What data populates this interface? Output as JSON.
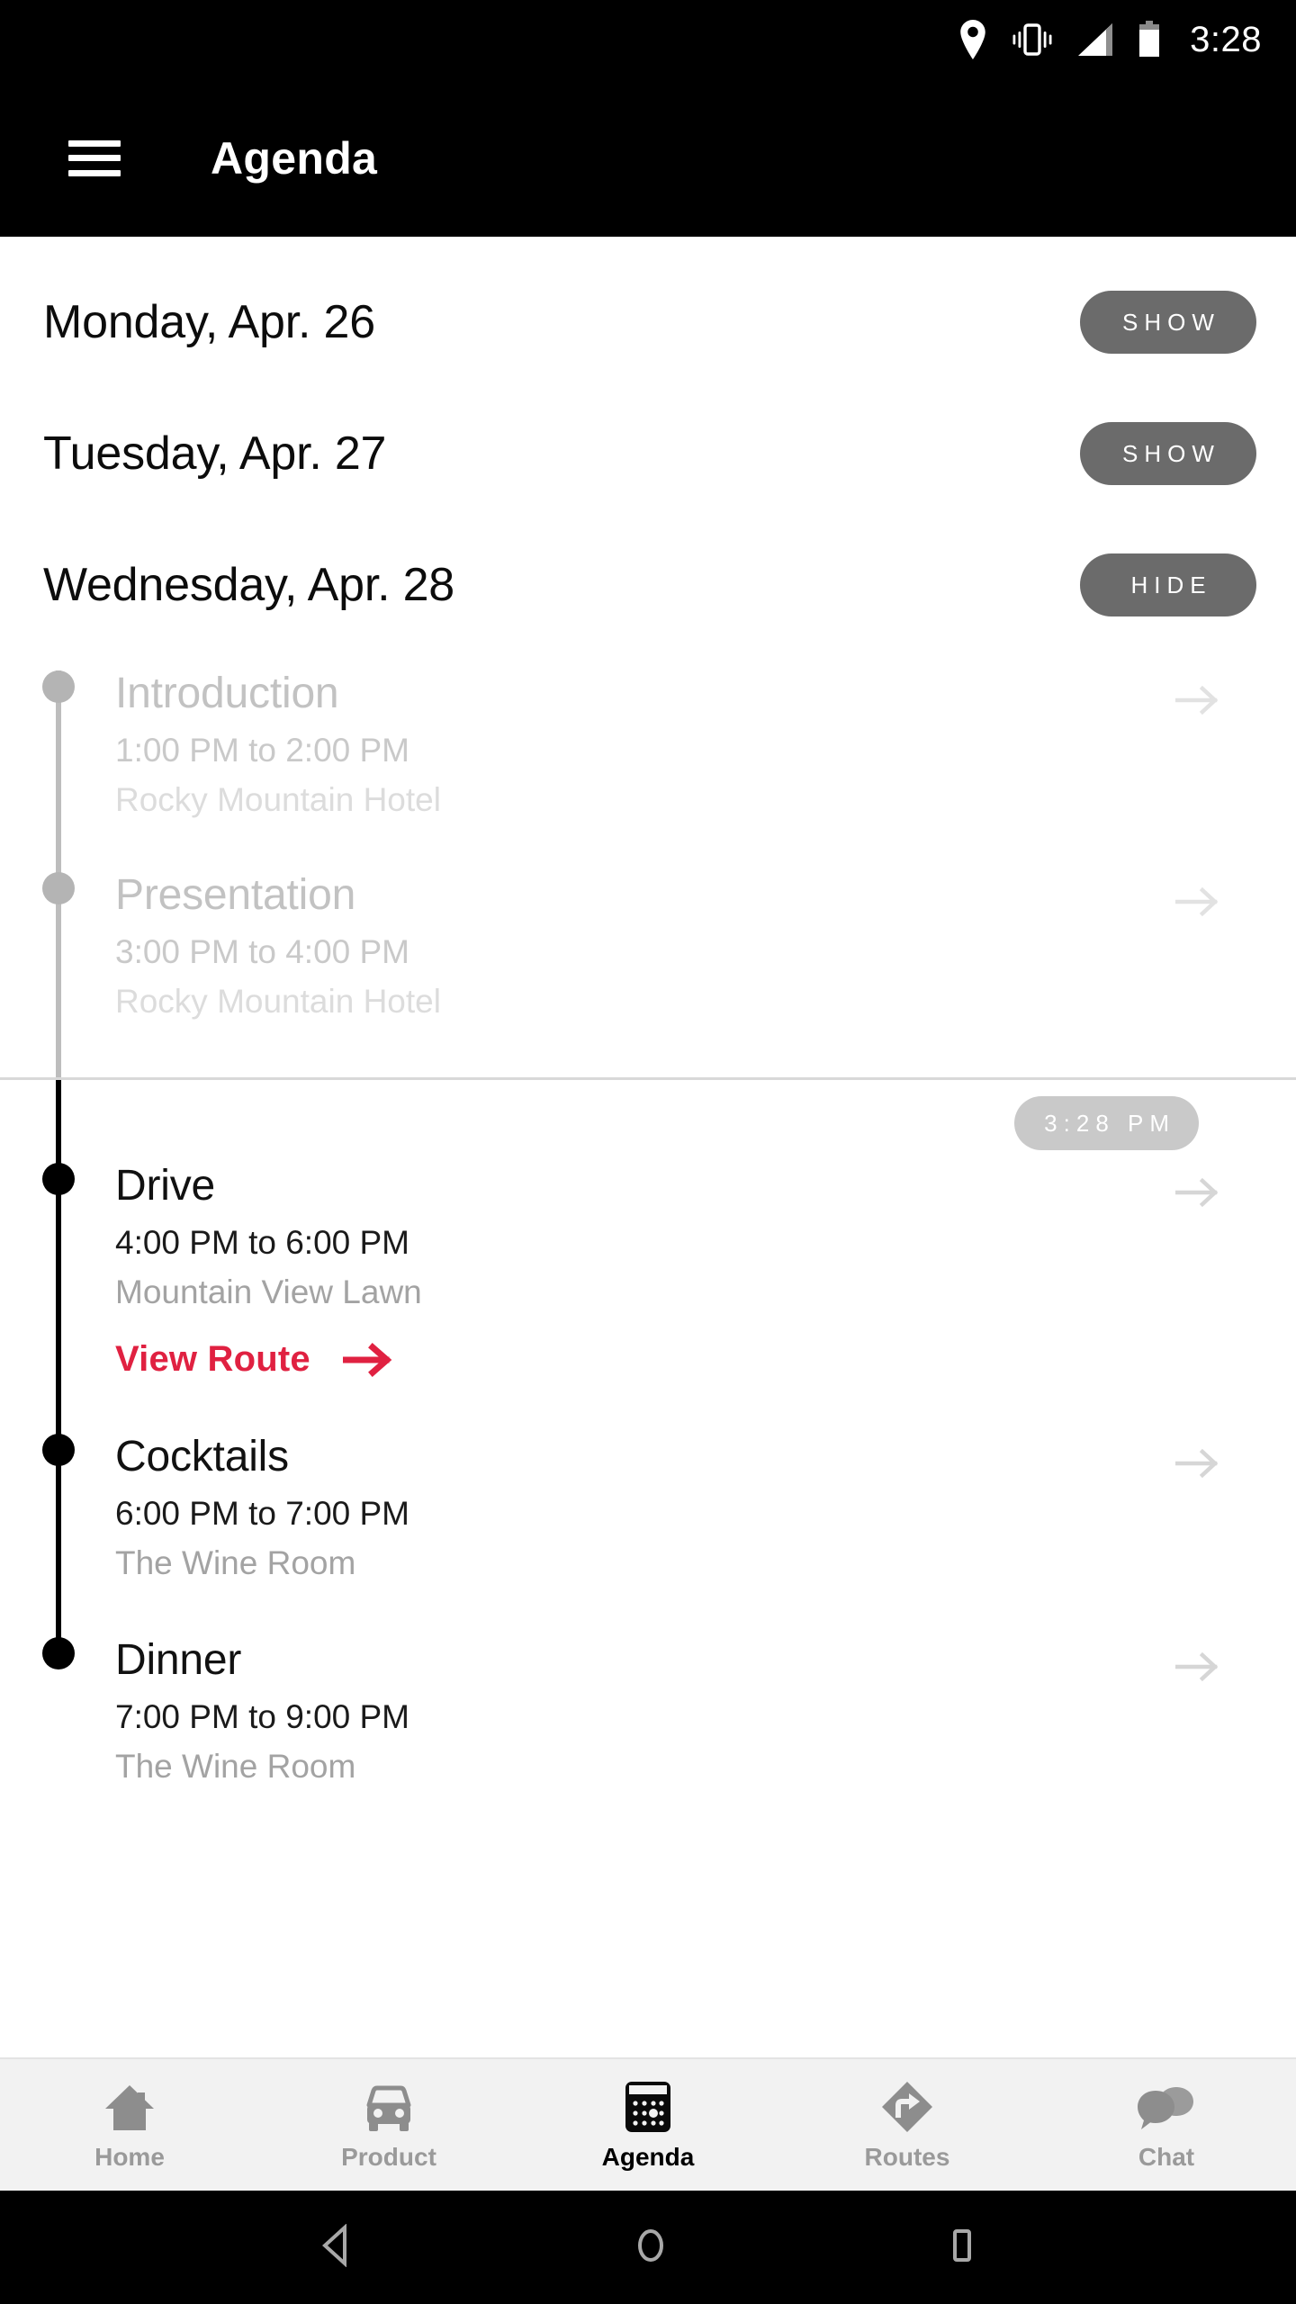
{
  "statusbar": {
    "time": "3:28",
    "icons": [
      "location-pin-icon",
      "vibrate-icon",
      "signal-icon",
      "battery-icon"
    ]
  },
  "appbar": {
    "menu_icon": "hamburger-menu-icon",
    "title": "Agenda"
  },
  "days": [
    {
      "label": "Monday, Apr. 26",
      "action": "SHOW",
      "expanded": false
    },
    {
      "label": "Tuesday, Apr. 27",
      "action": "SHOW",
      "expanded": false
    },
    {
      "label": "Wednesday, Apr. 28",
      "action": "HIDE",
      "expanded": true
    }
  ],
  "now_marker": {
    "time": "3 : 2 8  P M",
    "raw": "3:28 PM"
  },
  "events": [
    {
      "title": "Introduction",
      "time": "1:00 PM to 2:00 PM",
      "location": "Rocky Mountain Hotel",
      "state": "past",
      "arrow": "chevron-right-arrow-icon"
    },
    {
      "title": "Presentation",
      "time": "3:00 PM to 4:00 PM",
      "location": "Rocky Mountain Hotel",
      "state": "past",
      "arrow": "chevron-right-arrow-icon"
    },
    {
      "title": "Drive",
      "time": "4:00 PM to 6:00 PM",
      "location": "Mountain View Lawn",
      "state": "active",
      "arrow": "chevron-right-arrow-icon",
      "route_link": "View Route"
    },
    {
      "title": "Cocktails",
      "time": "6:00 PM to 7:00 PM",
      "location": "The Wine Room",
      "state": "active",
      "arrow": "chevron-right-arrow-icon"
    },
    {
      "title": "Dinner",
      "time": "7:00 PM to 9:00 PM",
      "location": "The Wine Room",
      "state": "active",
      "arrow": "chevron-right-arrow-icon"
    }
  ],
  "bottomnav": {
    "items": [
      {
        "label": "Home",
        "icon": "house-icon",
        "active": false
      },
      {
        "label": "Product",
        "icon": "car-icon",
        "active": false
      },
      {
        "label": "Agenda",
        "icon": "calendar-icon",
        "active": true
      },
      {
        "label": "Routes",
        "icon": "turn-right-diamond-icon",
        "active": false
      },
      {
        "label": "Chat",
        "icon": "speech-bubbles-icon",
        "active": false
      }
    ]
  },
  "androidnav": {
    "back": "back-triangle-icon",
    "home": "home-circle-icon",
    "recents": "recents-square-icon"
  },
  "colors": {
    "accent_red": "#e02141",
    "pill_gray": "#6b6b6b",
    "now_badge_gray": "#c9c9c9",
    "nav_bg": "#f2f2f2",
    "bar_black": "#000000"
  }
}
